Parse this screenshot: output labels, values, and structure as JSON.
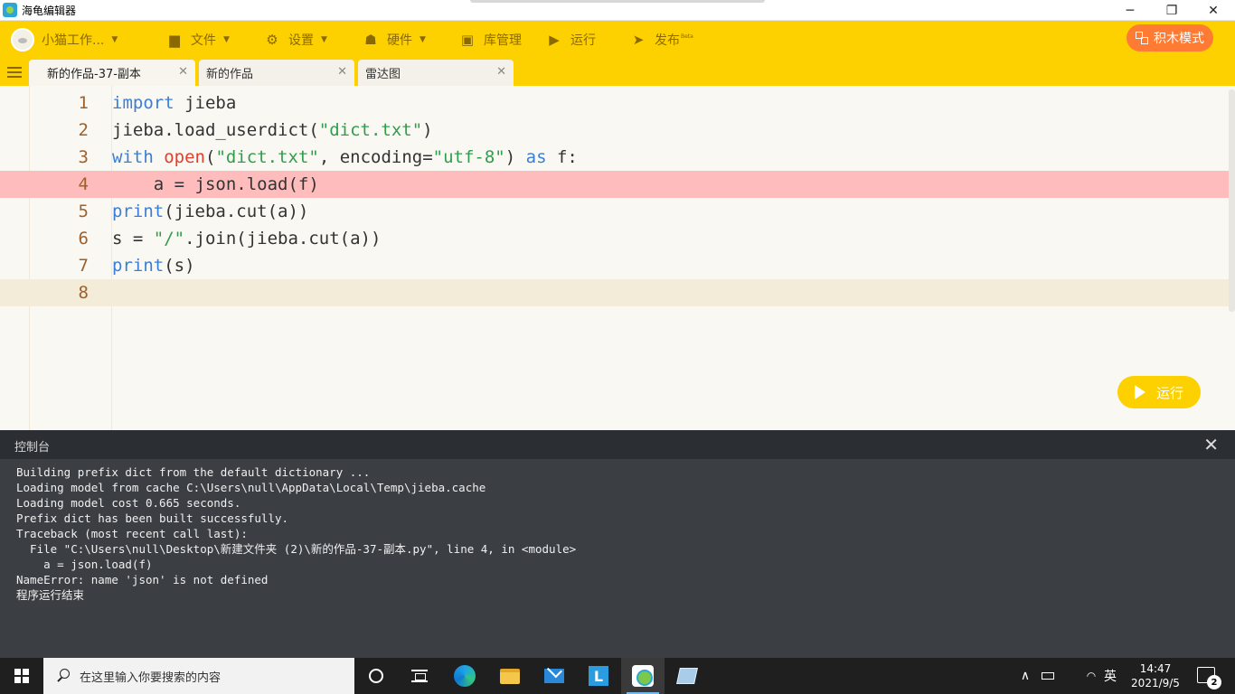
{
  "window": {
    "title": "海龟编辑器",
    "minimize_icon": "─",
    "restore_icon": "❐",
    "close_icon": "✕"
  },
  "toolbar": {
    "user_label": "小猫工作...",
    "file_label": "文件",
    "settings_label": "设置",
    "hardware_label": "硬件",
    "library_label": "库管理",
    "run_label": "运行",
    "publish_label": "发布",
    "publish_badge": "Beta",
    "block_mode_label": "积木模式"
  },
  "tabs": [
    {
      "label": "新的作品-37-副本",
      "close": "✕"
    },
    {
      "label": "新的作品",
      "close": "✕"
    },
    {
      "label": "雷达图",
      "close": "✕"
    }
  ],
  "editor": {
    "line_numbers": [
      "1",
      "2",
      "3",
      "4",
      "5",
      "6",
      "7",
      "8"
    ],
    "lines": [
      [
        {
          "t": "import",
          "c": "kw"
        },
        {
          "t": " jieba",
          "c": ""
        }
      ],
      [
        {
          "t": "jieba.load_userdict(",
          "c": ""
        },
        {
          "t": "\"dict.txt\"",
          "c": "str"
        },
        {
          "t": ")",
          "c": ""
        }
      ],
      [
        {
          "t": "with",
          "c": "kw"
        },
        {
          "t": " ",
          "c": ""
        },
        {
          "t": "open",
          "c": "bi2"
        },
        {
          "t": "(",
          "c": ""
        },
        {
          "t": "\"dict.txt\"",
          "c": "str"
        },
        {
          "t": ", encoding=",
          "c": ""
        },
        {
          "t": "\"utf-8\"",
          "c": "str"
        },
        {
          "t": ") ",
          "c": ""
        },
        {
          "t": "as",
          "c": "kw"
        },
        {
          "t": " f:",
          "c": ""
        }
      ],
      [
        {
          "t": "    a = json.load(f)",
          "c": ""
        }
      ],
      [
        {
          "t": "print",
          "c": "kw"
        },
        {
          "t": "(jieba.cut(a))",
          "c": ""
        }
      ],
      [
        {
          "t": "s = ",
          "c": ""
        },
        {
          "t": "\"/\"",
          "c": "str"
        },
        {
          "t": ".join(jieba.cut(a))",
          "c": ""
        }
      ],
      [
        {
          "t": "print",
          "c": "kw"
        },
        {
          "t": "(s)",
          "c": ""
        }
      ],
      [
        {
          "t": "",
          "c": ""
        }
      ]
    ],
    "error_line": 4,
    "current_line": 8,
    "run_button_label": "运行"
  },
  "console": {
    "title": "控制台",
    "close_icon": "✕",
    "lines": [
      "Building prefix dict from the default dictionary ...",
      "Loading model from cache C:\\Users\\null\\AppData\\Local\\Temp\\jieba.cache",
      "Loading model cost 0.665 seconds.",
      "Prefix dict has been built successfully.",
      "Traceback (most recent call last):",
      "  File \"C:\\Users\\null\\Desktop\\新建文件夹 (2)\\新的作品-37-副本.py\", line 4, in <module>",
      "    a = json.load(f)",
      "NameError: name 'json' is not defined",
      "程序运行结束"
    ]
  },
  "taskbar": {
    "search_placeholder": "在这里输入你要搜索的内容",
    "lang_label": "英",
    "time": "14:47",
    "date": "2021/9/5",
    "notification_count": "2",
    "tray_up_icon": "∧"
  },
  "colors": {
    "toolbar": "#fdd000",
    "accent_orange": "#ff7a32",
    "error_line": "#ffbcbc",
    "console_bg": "#3b3f44"
  }
}
